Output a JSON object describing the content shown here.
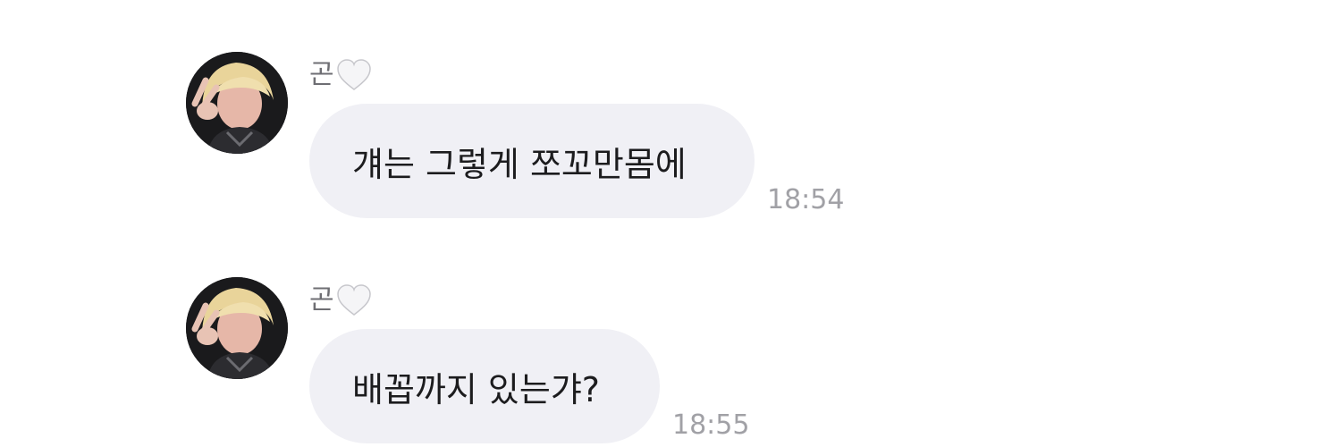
{
  "chat": {
    "messages": [
      {
        "sender": "곤",
        "sender_badge_icon": "white-heart-icon",
        "avatar_icon": "user-avatar-icon",
        "text": "걔는 그렇게 쪼꼬만몸에",
        "time": "18:54"
      },
      {
        "sender": "곤",
        "sender_badge_icon": "white-heart-icon",
        "avatar_icon": "user-avatar-icon",
        "text": "배꼽까지 있는갸?",
        "time": "18:55"
      }
    ]
  },
  "colors": {
    "bubble_background": "#f0f0f5",
    "message_text": "#1c1c1e",
    "sender_text": "#6e6e73",
    "timestamp_text": "#a1a1a6",
    "heart_fill": "#f5f5f7",
    "heart_stroke": "#c7c7cc"
  }
}
